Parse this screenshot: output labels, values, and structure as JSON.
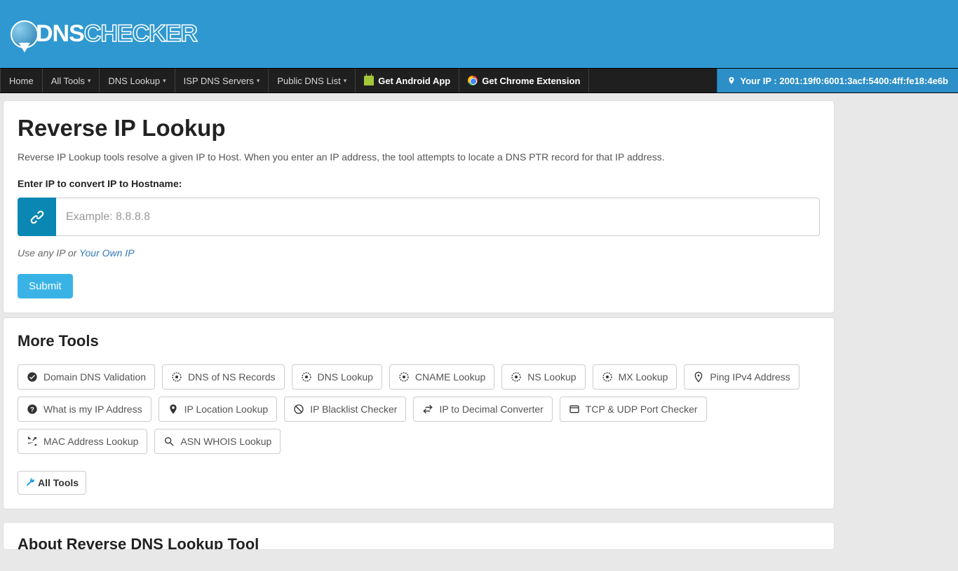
{
  "logo": {
    "part1": "DNS",
    "part2": "CHECKER"
  },
  "nav": {
    "items": [
      "Home",
      "All Tools",
      "DNS Lookup",
      "ISP DNS Servers",
      "Public DNS List"
    ],
    "android": "Get Android App",
    "chrome": "Get Chrome Extension",
    "ip_label": "Your IP :",
    "ip_value": "2001:19f0:6001:3acf:5400:4ff:fe18:4e6b"
  },
  "main": {
    "title": "Reverse IP Lookup",
    "description": "Reverse IP Lookup tools resolve a given IP to Host. When you enter an IP address, the tool attempts to locate a DNS PTR record for that IP address.",
    "form_label": "Enter IP to convert IP to Hostname:",
    "placeholder": "Example: 8.8.8.8",
    "helper_text": "Use any IP or ",
    "helper_link": "Your Own IP",
    "submit": "Submit"
  },
  "more_tools": {
    "title": "More Tools",
    "items": [
      "Domain DNS Validation",
      "DNS of NS Records",
      "DNS Lookup",
      "CNAME Lookup",
      "NS Lookup",
      "MX Lookup",
      "Ping IPv4 Address",
      "What is my IP Address",
      "IP Location Lookup",
      "IP Blacklist Checker",
      "IP to Decimal Converter",
      "TCP & UDP Port Checker",
      "MAC Address Lookup",
      "ASN WHOIS Lookup"
    ],
    "all_tools": "All Tools"
  },
  "about": {
    "title": "About Reverse DNS Lookup Tool"
  }
}
